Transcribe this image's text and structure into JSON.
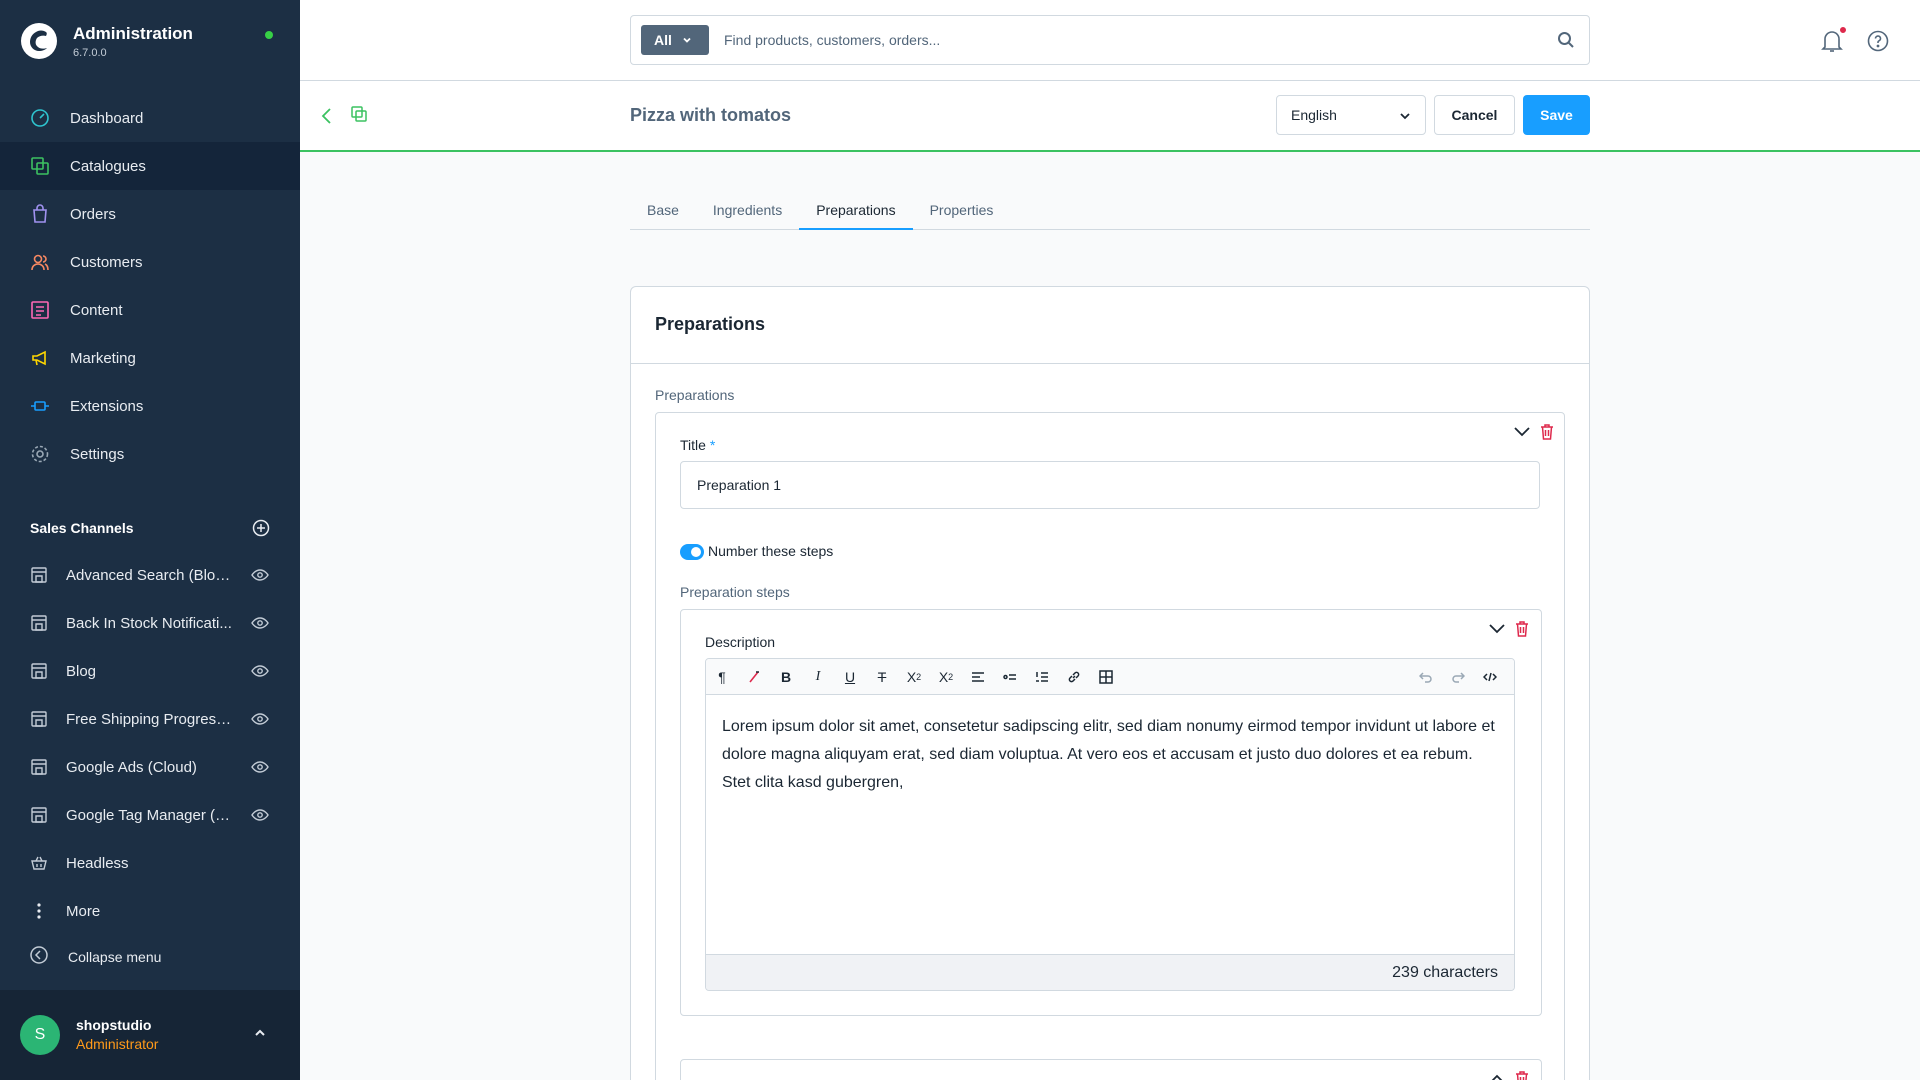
{
  "brand": {
    "title": "Administration",
    "version": "6.7.0.0"
  },
  "nav": {
    "items": [
      {
        "label": "Dashboard"
      },
      {
        "label": "Catalogues"
      },
      {
        "label": "Orders"
      },
      {
        "label": "Customers"
      },
      {
        "label": "Content"
      },
      {
        "label": "Marketing"
      },
      {
        "label": "Extensions"
      },
      {
        "label": "Settings"
      }
    ]
  },
  "sales_channels": {
    "title": "Sales Channels",
    "items": [
      {
        "label": "Advanced Search (Blog ..."
      },
      {
        "label": "Back In Stock Notificati..."
      },
      {
        "label": "Blog"
      },
      {
        "label": "Free Shipping Progress ..."
      },
      {
        "label": "Google Ads (Cloud)"
      },
      {
        "label": "Google Tag Manager (C..."
      },
      {
        "label": "Headless"
      },
      {
        "label": "More"
      }
    ],
    "collapse_label": "Collapse menu"
  },
  "user": {
    "initial": "S",
    "name": "shopstudio",
    "role": "Administrator"
  },
  "search": {
    "type_label": "All",
    "placeholder": "Find products, customers, orders..."
  },
  "smartbar": {
    "title": "Pizza with tomatos",
    "language": "English",
    "cancel_label": "Cancel",
    "save_label": "Save"
  },
  "tabs": [
    {
      "label": "Base"
    },
    {
      "label": "Ingredients"
    },
    {
      "label": "Preparations"
    },
    {
      "label": "Properties"
    }
  ],
  "card": {
    "title": "Preparations",
    "section_label": "Preparations",
    "preparation": {
      "title_label": "Title",
      "required_mark": "*",
      "title_value": "Preparation 1",
      "toggle_label": "Number these steps",
      "steps_label": "Preparation steps",
      "step": {
        "description_label": "Description",
        "content": "Lorem ipsum dolor sit amet, consetetur sadipscing elitr, sed diam nonumy eirmod tempor invidunt ut labore et dolore magna aliquyam erat, sed diam voluptua. At vero eos et accusam et justo duo dolores et ea rebum. Stet clita kasd gubergren,",
        "char_count": "239 characters"
      }
    }
  },
  "colors": {
    "sidebar_bg": "#1c2f44",
    "accent": "#189eff",
    "danger": "#de294c",
    "success": "#3cc261",
    "role": "#ff9a1a"
  }
}
